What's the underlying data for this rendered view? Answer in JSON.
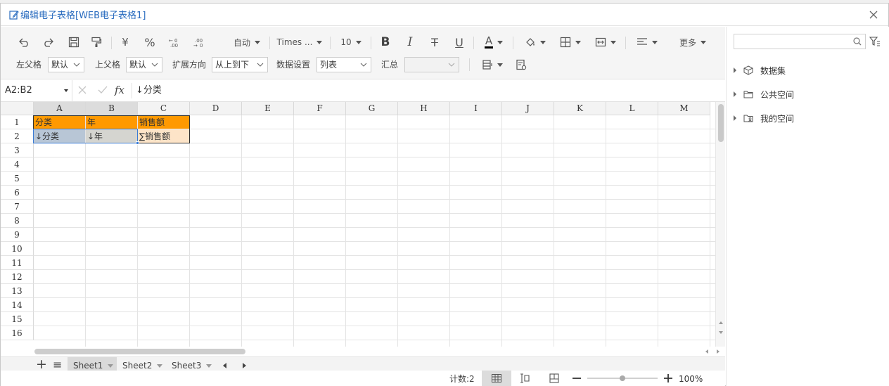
{
  "window": {
    "title": "编辑电子表格[WEB电子表格1]"
  },
  "toolbar": {
    "currency": "¥",
    "percent": "%",
    "auto_label": "自动",
    "font_name": "Times ...",
    "font_size": "10",
    "bold": "B",
    "italic": "I",
    "strike": "T",
    "underline": "U",
    "font_color": "A",
    "more_label": "更多",
    "left_parent_label": "左父格",
    "left_parent_value": "默认",
    "top_parent_label": "上父格",
    "top_parent_value": "默认",
    "expand_label": "扩展方向",
    "expand_value": "从上到下",
    "data_setting_label": "数据设置",
    "data_setting_value": "列表",
    "summary_label": "汇总",
    "summary_value": ""
  },
  "formula": {
    "name_box": "A2:B2",
    "fx": "fx",
    "content": "↓分类"
  },
  "grid": {
    "columns": [
      "A",
      "B",
      "C",
      "D",
      "E",
      "F",
      "G",
      "H",
      "I",
      "J",
      "K",
      "L",
      "M"
    ],
    "rows": [
      "1",
      "2",
      "3",
      "4",
      "5",
      "6",
      "7",
      "8",
      "9",
      "10",
      "11",
      "12",
      "13",
      "14",
      "15",
      "16"
    ],
    "cells": {
      "A1": "分类",
      "B1": "年",
      "C1": "销售额",
      "A2": "↓分类",
      "B2": "↓年",
      "C2": "∑销售额"
    },
    "colors": {
      "header_fill": "#ff9900",
      "selected_fill": "#b8c6d6",
      "b2_fill": "#d5d5d0",
      "c2_fill": "#fde4c8"
    }
  },
  "sheets": {
    "add": "+",
    "menu": "≡",
    "tabs": [
      "Sheet1",
      "Sheet2",
      "Sheet3"
    ],
    "active": "Sheet1"
  },
  "status": {
    "count": "计数:2",
    "zoom": "100%",
    "zoom_level": 1.0
  },
  "right_panel": {
    "search_value": "",
    "tree": [
      "数据集",
      "公共空间",
      "我的空间"
    ]
  }
}
